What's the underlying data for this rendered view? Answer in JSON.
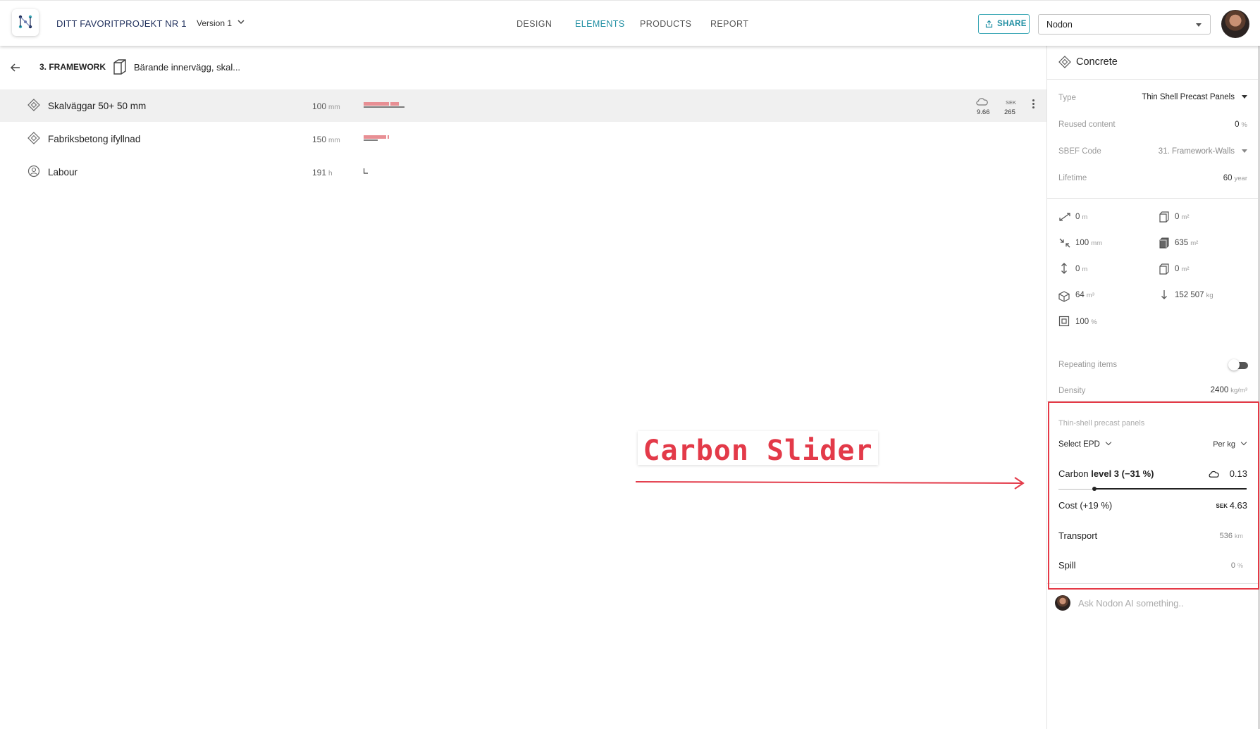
{
  "header": {
    "logo_icon": "nodon-logo-icon",
    "project_title": "DITT FAVORITPROJEKT NR 1",
    "version": "Version 1",
    "tabs": [
      {
        "label": "DESIGN",
        "active": false
      },
      {
        "label": "ELEMENTS",
        "active": true
      },
      {
        "label": "PRODUCTS",
        "active": false
      },
      {
        "label": "REPORT",
        "active": false
      }
    ],
    "share_label": "SHARE",
    "organization": "Nodon",
    "accent_color": "#1f8ea2"
  },
  "breadcrumb": {
    "section": "3. FRAMEWORK",
    "element": "Bärande innervägg, skal..."
  },
  "rows": [
    {
      "icon": "material-icon",
      "name": "Skalväggar 50+ 50 mm",
      "qty": "100",
      "unit": "mm",
      "co2": "9.66",
      "sek_label": "SEK",
      "sek": "265",
      "selected": true
    },
    {
      "icon": "material-icon",
      "name": "Fabriksbetong ifyllnad",
      "qty": "150",
      "unit": "mm"
    },
    {
      "icon": "labour-icon",
      "name": "Labour",
      "qty": "191",
      "unit": "h"
    }
  ],
  "panel": {
    "title": "Concrete",
    "type_label": "Type",
    "type_value": "Thin Shell Precast Panels",
    "reused_label": "Reused content",
    "reused_value": "0",
    "reused_unit": "%",
    "sbef_label": "SBEF Code",
    "sbef_value": "31. Framework-Walls",
    "lifetime_label": "Lifetime",
    "lifetime_value": "60",
    "lifetime_unit": "year",
    "dims": [
      {
        "icon": "length-icon",
        "value": "0",
        "unit": "m"
      },
      {
        "icon": "area-icon",
        "value": "0",
        "unit": "m²"
      },
      {
        "icon": "thickness-icon",
        "value": "100",
        "unit": "mm"
      },
      {
        "icon": "area-solid-icon",
        "value": "635",
        "unit": "m²"
      },
      {
        "icon": "height-icon",
        "value": "0",
        "unit": "m"
      },
      {
        "icon": "area-icon",
        "value": "0",
        "unit": "m²"
      },
      {
        "icon": "volume-icon",
        "value": "64",
        "unit": "m³"
      },
      {
        "icon": "weight-icon",
        "value": "152 507",
        "unit": "kg"
      },
      {
        "icon": "percent-box-icon",
        "value": "100",
        "unit": "%"
      }
    ],
    "repeating_label": "Repeating items",
    "repeating_enabled": false,
    "density_label": "Density",
    "density_value": "2400",
    "density_unit": "kg/m³"
  },
  "epd": {
    "section_label": "Thin-shell precast panels",
    "select_label": "Select EPD",
    "per_label": "Per kg",
    "carbon_prefix": "Carbon",
    "carbon_level": "level 3 (−31 %)",
    "carbon_value": "0.13",
    "carbon_slider_fraction": 0.19,
    "cost_label": "Cost (+19 %)",
    "cost_currency": "SEK",
    "cost_value": "4.63",
    "transport_label": "Transport",
    "transport_value": "536",
    "transport_unit": "km",
    "spill_label": "Spill",
    "spill_value": "0",
    "spill_unit": "%",
    "highlight_color": "#e53946"
  },
  "ai": {
    "placeholder": "Ask Nodon AI something.."
  },
  "annotation": {
    "text": "Carbon Slider",
    "color": "#e33a49"
  }
}
